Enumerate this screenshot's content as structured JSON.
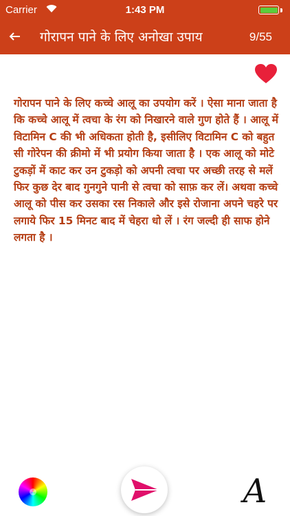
{
  "status_bar": {
    "carrier": "Carrier",
    "time": "1:43 PM",
    "battery_color": "#5ccd3c"
  },
  "nav": {
    "back_icon": "back-arrow-icon",
    "title": "गोरापन पाने के लिए अनोखा उपाय",
    "page_counter": "9/55",
    "bar_color": "#cc4019"
  },
  "favorite": {
    "icon": "heart-icon",
    "color": "#e8203a"
  },
  "article": {
    "text": "गोरापन पाने के लिए कच्चे आलू का उपयोग करें । ऐसा माना जाता है कि कच्चे आलू में त्वचा के रंग को निखारने वाले गुण होते हैं । आलू में विटामिन C की भी अधिकता होती है, इसीलिए विटामिन C को बहुत सी गोरेपन की क्रीमो में भी प्रयोग किया जाता है । एक आलू को मोटे टुकड़ों में काट कर उन टुकड़ो को अपनी त्वचा पर अच्छी तरह से मलें फिर कुछ देर बाद गुनगुने पानी से त्वचा को साफ़ कर लें। अथवा कच्चे आलू को पीस कर उसका रस निकाले और इसे रोजाना अपने चहरे पर लगाये फिर 15 मिनट बाद में चेहरा धो लें । रंग जल्दी ही साफ होने लगता है ।",
    "text_color": "#b53e14"
  },
  "toolbar": {
    "color_wheel_icon": "color-wheel-icon",
    "send_icon": "send-icon",
    "send_color": "#e0106b",
    "font_label": "A"
  }
}
